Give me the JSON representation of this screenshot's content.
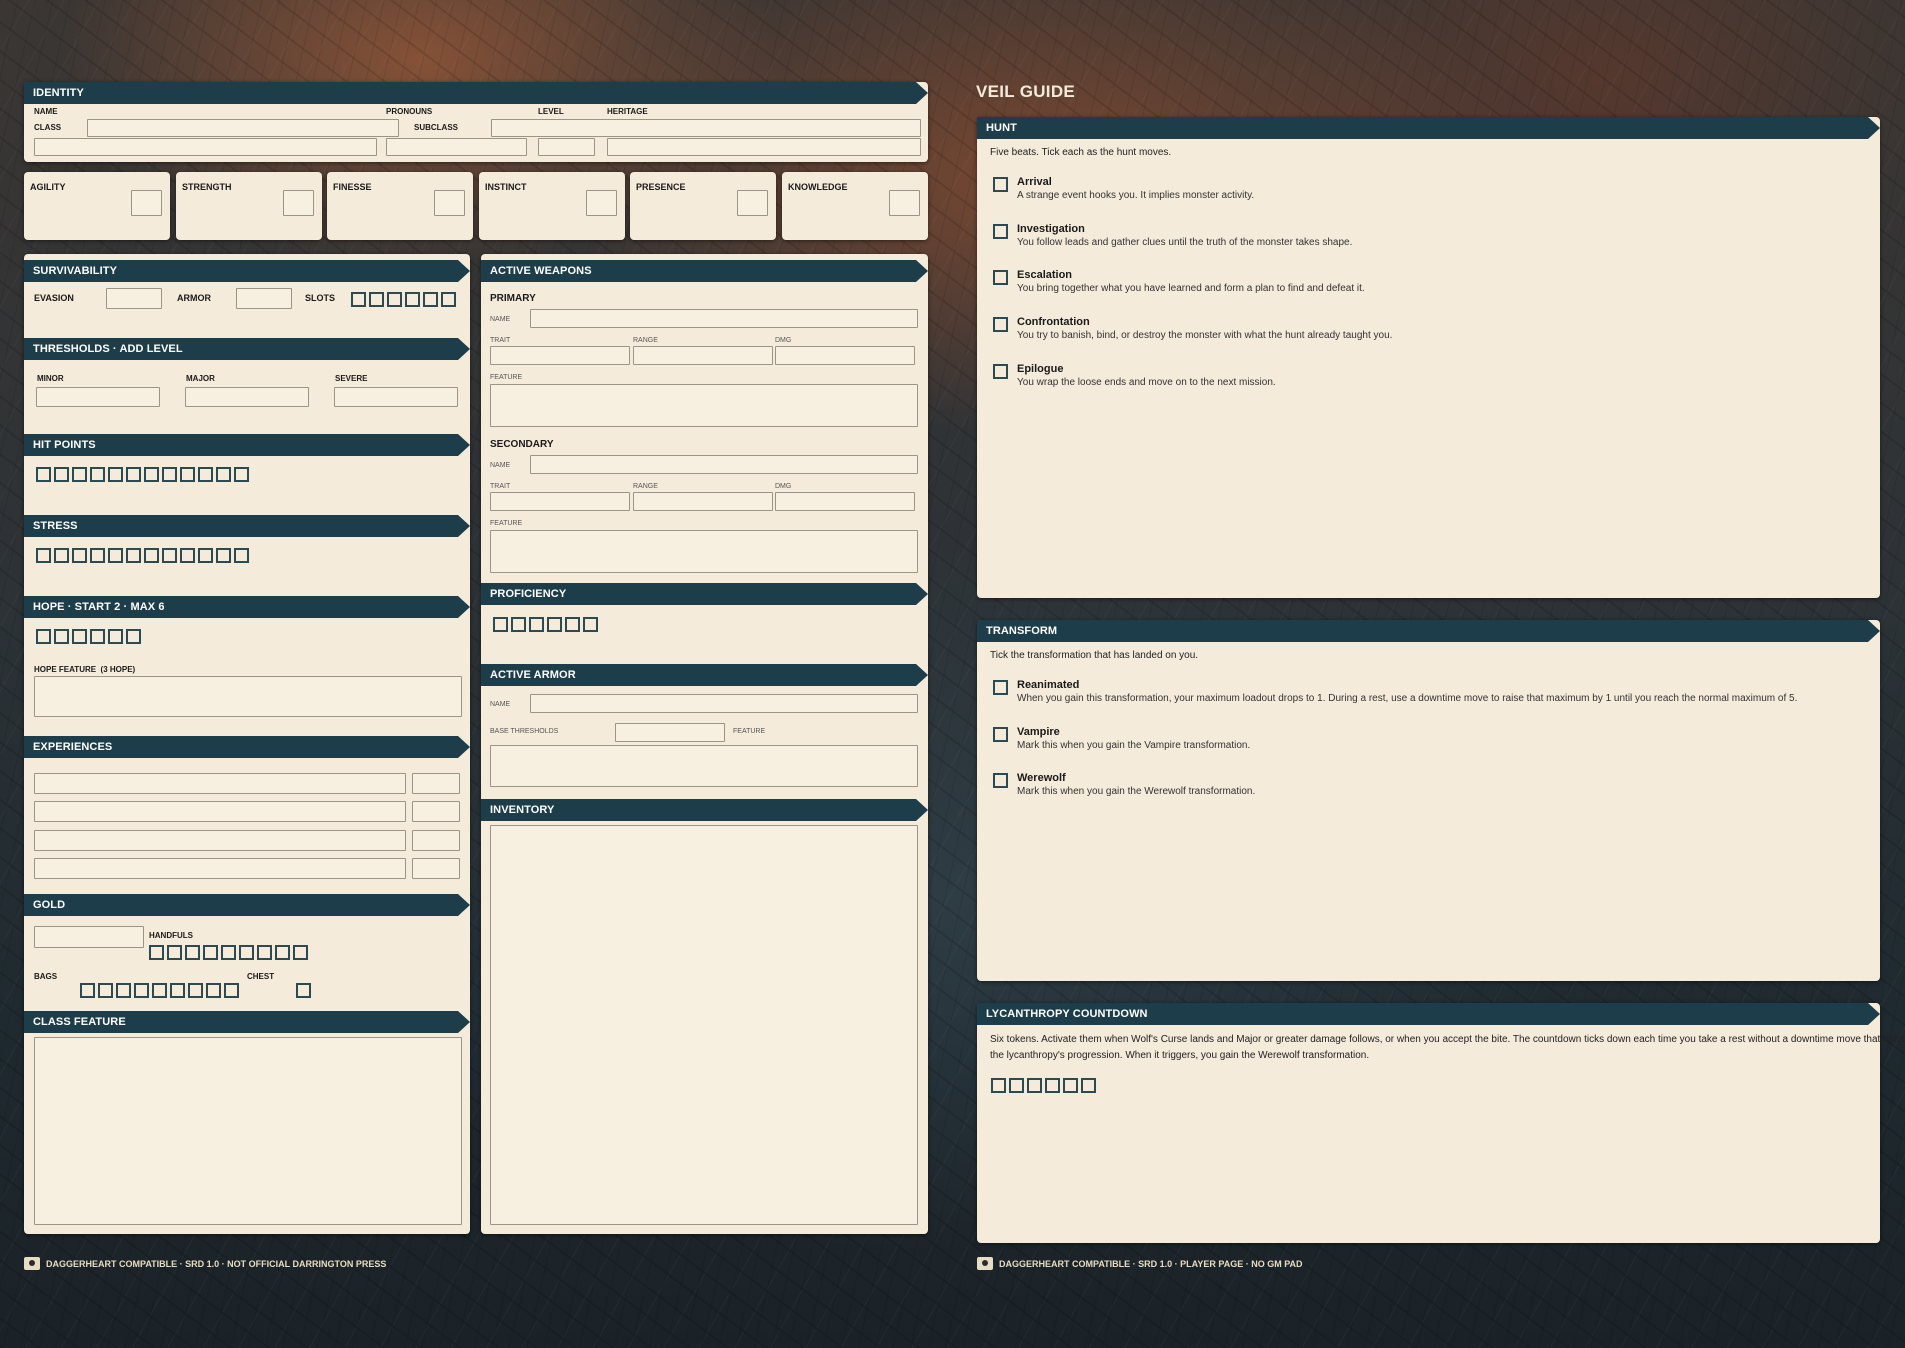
{
  "identity": {
    "header": "IDENTITY",
    "name_label": "NAME",
    "pronouns_label": "PRONOUNS",
    "level_label": "LEVEL",
    "heritage_label": "HERITAGE",
    "class_label": "CLASS",
    "subclass_label": "SUBCLASS"
  },
  "traits": [
    "AGILITY",
    "STRENGTH",
    "FINESSE",
    "INSTINCT",
    "PRESENCE",
    "KNOWLEDGE"
  ],
  "survivability": {
    "header": "SURVIVABILITY",
    "evasion_label": "EVASION",
    "armor_label": "ARMOR",
    "slots_label": "SLOTS",
    "slots_count": 6
  },
  "thresholds": {
    "header": "THRESHOLDS · ADD LEVEL",
    "minor_label": "MINOR",
    "major_label": "MAJOR",
    "severe_label": "SEVERE"
  },
  "hit_points": {
    "header": "HIT POINTS",
    "count": 12
  },
  "stress": {
    "header": "STRESS",
    "count": 12
  },
  "hope": {
    "header": "HOPE · START 2 · MAX 6",
    "count": 6,
    "feature_label": "HOPE FEATURE  (3 HOPE)"
  },
  "experiences": {
    "header": "EXPERIENCES",
    "rows": 4
  },
  "gold": {
    "header": "GOLD",
    "handfuls_label": "HANDFULS",
    "handfuls_count": 9,
    "bags_label": "BAGS",
    "bags_count": 9,
    "chest_label": "CHEST",
    "chest_count": 1
  },
  "class_feature": {
    "header": "CLASS FEATURE"
  },
  "weapons": {
    "header": "ACTIVE WEAPONS",
    "primary_label": "PRIMARY",
    "secondary_label": "SECONDARY",
    "name_label": "NAME",
    "trait_label": "TRAIT",
    "range_label": "RANGE",
    "dmg_label": "DMG",
    "feature_label": "FEATURE"
  },
  "proficiency": {
    "header": "PROFICIENCY",
    "count": 6
  },
  "armor": {
    "header": "ACTIVE ARMOR",
    "name_label": "NAME",
    "base_thresholds_label": "BASE THRESHOLDS",
    "feature_label": "FEATURE"
  },
  "inventory": {
    "header": "INVENTORY"
  },
  "guide": {
    "title": "VEIL GUIDE",
    "hunt": {
      "header": "HUNT",
      "intro": "Five beats. Tick each as the hunt moves.",
      "items": [
        {
          "title": "Arrival",
          "desc": "A strange event hooks you. It implies monster activity."
        },
        {
          "title": "Investigation",
          "desc": "You follow leads and gather clues until the truth of the monster takes shape."
        },
        {
          "title": "Escalation",
          "desc": "You bring together what you have learned and form a plan to find and defeat it."
        },
        {
          "title": "Confrontation",
          "desc": "You try to banish, bind, or destroy the monster with what the hunt already taught you."
        },
        {
          "title": "Epilogue",
          "desc": "You wrap the loose ends and move on to the next mission."
        }
      ]
    },
    "transform": {
      "header": "TRANSFORM",
      "intro": "Tick the transformation that has landed on you.",
      "items": [
        {
          "title": "Reanimated",
          "desc": "When you gain this transformation, your maximum loadout drops to 1. During a rest, use a downtime move to raise that maximum by 1 until you reach the normal maximum of 5."
        },
        {
          "title": "Vampire",
          "desc": "Mark this when you gain the Vampire transformation."
        },
        {
          "title": "Werewolf",
          "desc": "Mark this when you gain the Werewolf transformation."
        }
      ]
    },
    "lycanthropy": {
      "header": "LYCANTHROPY COUNTDOWN",
      "intro_line1": "Six tokens. Activate them when Wolf's Curse lands and Major or greater damage follows, or when you accept the bite. The countdown ticks down each time you take a rest without a downtime move that halts",
      "intro_line2": "the lycanthropy's progression. When it triggers, you gain the Werewolf transformation.",
      "count": 6
    }
  },
  "footer_left": "DAGGERHEART COMPATIBLE · SRD 1.0 · NOT OFFICIAL DARRINGTON PRESS",
  "footer_right": "DAGGERHEART COMPATIBLE · SRD 1.0 · PLAYER PAGE · NO GM PAD"
}
